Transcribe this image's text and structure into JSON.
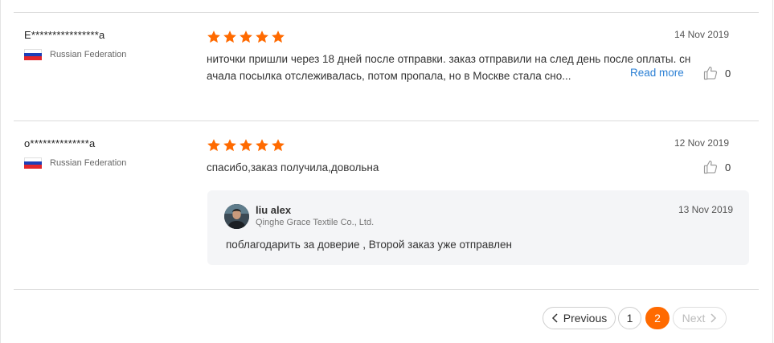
{
  "reviews": [
    {
      "user": "E****************a",
      "country": "Russian Federation",
      "rating": 5,
      "date": "14 Nov 2019",
      "text_line1": "ниточки пришли через 18 дней после отправки. заказ отправили на след день после оплаты. сн",
      "text_line2": "ачала посылка отслеживалась, потом пропала, но в Москве стала сно...",
      "read_more": "Read more",
      "likes": "0"
    },
    {
      "user": "o**************a",
      "country": "Russian Federation",
      "rating": 5,
      "date": "12 Nov 2019",
      "text_line1": "спасибо,заказ получила,довольна",
      "likes": "0",
      "reply": {
        "name": "liu alex",
        "company": "Qinghe Grace Textile Co., Ltd.",
        "date": "13 Nov 2019",
        "text": "поблагодарить за доверие , Второй заказ уже отправлен"
      }
    }
  ],
  "pagination": {
    "previous": "Previous",
    "pages": [
      "1",
      "2"
    ],
    "current": "2",
    "next": "Next"
  },
  "colors": {
    "star": "#ff6a00",
    "accent": "#ff6a00",
    "link": "#2a7fd4",
    "reply_bg": "#f4f5f7"
  }
}
